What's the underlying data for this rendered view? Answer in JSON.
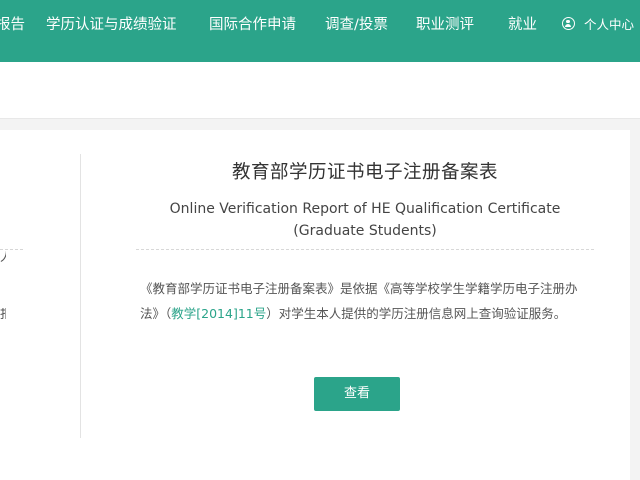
{
  "nav": {
    "items": [
      {
        "label": "报告"
      },
      {
        "label": "学历认证与成绩验证"
      },
      {
        "label": "国际合作申请"
      },
      {
        "label": "调查/投票"
      },
      {
        "label": "职业测评"
      },
      {
        "label": "就业"
      },
      {
        "label": "个人中心"
      }
    ],
    "user_icon": "user-circle-icon"
  },
  "sidebar": {
    "stubs": [
      {
        "label": "人"
      },
      {
        "label": "报"
      }
    ]
  },
  "report": {
    "title": "教育部学历证书电子注册备案表",
    "subtitle_line1": "Online Verification Report of HE Qualification Certificate",
    "subtitle_line2": "(Graduate Students)",
    "description_before": "《教育部学历证书电子注册备案表》是依据《高等学校学生学籍学历电子注册办法》（",
    "description_link": "教学[2014]11号",
    "description_after": "）对学生本人提供的学历注册信息网上查询验证服务。",
    "view_button": "查看"
  },
  "colors": {
    "brand": "#2ba48a",
    "background": "#f3f3f3",
    "text": "#333333"
  }
}
